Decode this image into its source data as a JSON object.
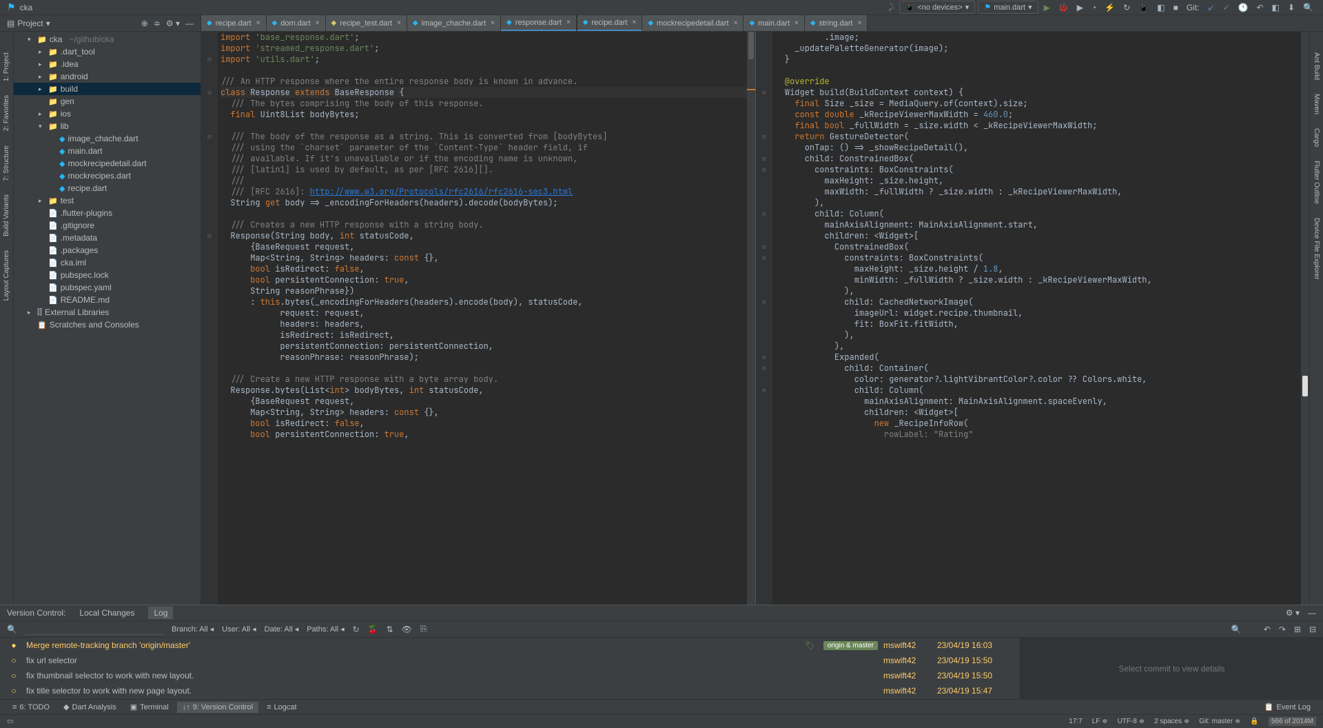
{
  "menubar": {
    "project_name": "cka",
    "devices": "<no devices>",
    "config": "main.dart",
    "git_label": "Git:"
  },
  "project_header": {
    "title": "Project"
  },
  "tabs_left": [
    {
      "name": "recipe.dart",
      "icon": "dart"
    },
    {
      "name": "dom.dart",
      "icon": "dart"
    },
    {
      "name": "recipe_test.dart",
      "icon": "gr"
    },
    {
      "name": "image_chache.dart",
      "icon": "dart"
    },
    {
      "name": "response.dart",
      "icon": "dart",
      "active": true
    }
  ],
  "tabs_right": [
    {
      "name": "recipe.dart",
      "icon": "dart",
      "active": true
    },
    {
      "name": "mockrecipedetail.dart",
      "icon": "dart"
    },
    {
      "name": "main.dart",
      "icon": "dart"
    },
    {
      "name": "string.dart",
      "icon": "dart"
    }
  ],
  "tree": [
    {
      "level": 0,
      "caret": "▾",
      "icon": "folder",
      "label": "cka",
      "hint": "~/github/cka"
    },
    {
      "level": 1,
      "caret": "▸",
      "icon": "folder-excl",
      "label": ".dart_tool"
    },
    {
      "level": 1,
      "caret": "▸",
      "icon": "folder-excl",
      "label": ".idea"
    },
    {
      "level": 1,
      "caret": "▸",
      "icon": "folder",
      "label": "android"
    },
    {
      "level": 1,
      "caret": "▸",
      "icon": "folder-excl",
      "label": "build",
      "selected": true
    },
    {
      "level": 1,
      "caret": "",
      "icon": "folder-src",
      "label": "gen"
    },
    {
      "level": 1,
      "caret": "▸",
      "icon": "folder",
      "label": "ios"
    },
    {
      "level": 1,
      "caret": "▾",
      "icon": "folder",
      "label": "lib"
    },
    {
      "level": 2,
      "caret": "",
      "icon": "dart",
      "label": "image_chache.dart"
    },
    {
      "level": 2,
      "caret": "",
      "icon": "dart",
      "label": "main.dart"
    },
    {
      "level": 2,
      "caret": "",
      "icon": "dart",
      "label": "mockrecipedetail.dart"
    },
    {
      "level": 2,
      "caret": "",
      "icon": "dart",
      "label": "mockrecipes.dart"
    },
    {
      "level": 2,
      "caret": "",
      "icon": "dart",
      "label": "recipe.dart"
    },
    {
      "level": 1,
      "caret": "▸",
      "icon": "folder-src",
      "label": "test"
    },
    {
      "level": 1,
      "caret": "",
      "icon": "file",
      "label": ".flutter-plugins"
    },
    {
      "level": 1,
      "caret": "",
      "icon": "file",
      "label": ".gitignore"
    },
    {
      "level": 1,
      "caret": "",
      "icon": "file",
      "label": ".metadata"
    },
    {
      "level": 1,
      "caret": "",
      "icon": "file",
      "label": ".packages"
    },
    {
      "level": 1,
      "caret": "",
      "icon": "file",
      "label": "cka.iml"
    },
    {
      "level": 1,
      "caret": "",
      "icon": "file",
      "label": "pubspec.lock"
    },
    {
      "level": 1,
      "caret": "",
      "icon": "yaml",
      "label": "pubspec.yaml"
    },
    {
      "level": 1,
      "caret": "",
      "icon": "file",
      "label": "README.md"
    },
    {
      "level": 0,
      "caret": "▸",
      "icon": "lib",
      "label": "External Libraries"
    },
    {
      "level": 0,
      "caret": "",
      "icon": "scratch",
      "label": "Scratches and Consoles"
    }
  ],
  "side_tabs_left": [
    "1: Project",
    "2: Favorites",
    "7: Structure",
    "Build Variants",
    "Layout Captures"
  ],
  "side_tabs_right": [
    "Ant Build",
    "Maven",
    "Cargo",
    "Flutter Outline",
    "Device File Explorer"
  ],
  "vc": {
    "title": "Version Control:",
    "tabs": [
      "Local Changes",
      "Log"
    ],
    "filters": {
      "branch": "Branch: All",
      "user": "User: All",
      "date": "Date: All",
      "paths": "Paths: All"
    },
    "commits": [
      {
        "msg": "Merge remote-tracking branch 'origin/master'",
        "tags": [
          "origin & master"
        ],
        "author": "mswift42",
        "date": "23/04/19 16:03",
        "highlight": true
      },
      {
        "msg": "fix url selector",
        "author": "mswift42",
        "date": "23/04/19 15:50"
      },
      {
        "msg": "fix thumbnail selector to work with new layout.",
        "author": "mswift42",
        "date": "23/04/19 15:50"
      },
      {
        "msg": "fix title selector to work with new page layout.",
        "author": "mswift42",
        "date": "23/04/19 15:47"
      }
    ],
    "details_placeholder": "Select commit to view details"
  },
  "tool_windows": [
    "6: TODO",
    "Dart Analysis",
    "Terminal",
    "9: Version Control",
    "Logcat"
  ],
  "event_log": "Event Log",
  "status": {
    "pos": "17:7",
    "line_sep": "LF",
    "enc": "UTF-8",
    "indent": "2 spaces",
    "git": "Git: master",
    "mem": "566 of 2014M"
  }
}
